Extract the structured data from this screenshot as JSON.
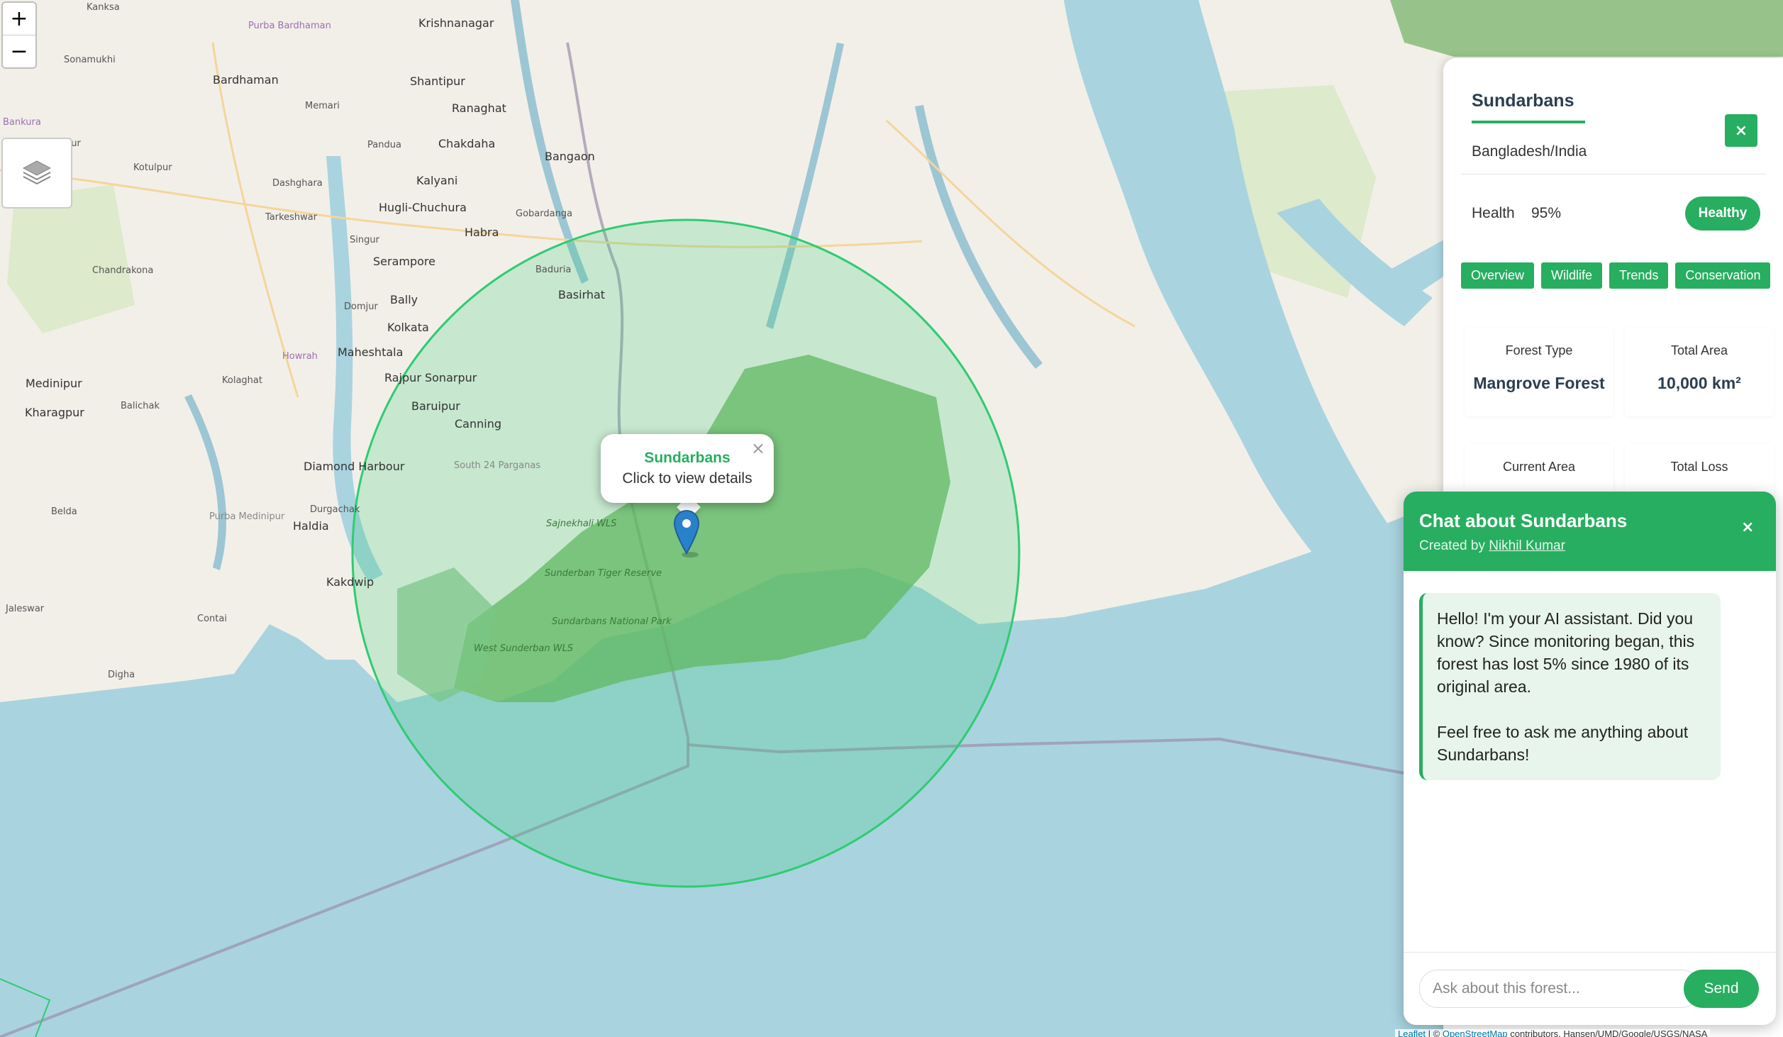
{
  "map": {
    "place_labels": [
      {
        "text": "Kanksa"
      },
      {
        "text": "Krishnanagar"
      },
      {
        "text": "Sonamukhi"
      },
      {
        "text": "Purba Bardhaman"
      },
      {
        "text": "Bardhaman"
      },
      {
        "text": "Shantipur"
      },
      {
        "text": "Memari"
      },
      {
        "text": "Ranaghat"
      },
      {
        "text": "Bankura"
      },
      {
        "text": "Bishnupur"
      },
      {
        "text": "Pandua"
      },
      {
        "text": "Chakdaha"
      },
      {
        "text": "Bangaon"
      },
      {
        "text": "Kotulpur"
      },
      {
        "text": "Dashghara"
      },
      {
        "text": "Kalyani"
      },
      {
        "text": "Hugli-Chuchura"
      },
      {
        "text": "Habra"
      },
      {
        "text": "Gobardanga"
      },
      {
        "text": "Tarkeshwar"
      },
      {
        "text": "Singur"
      },
      {
        "text": "Serampore"
      },
      {
        "text": "Chandrakona"
      },
      {
        "text": "Baduria"
      },
      {
        "text": "Basirhat"
      },
      {
        "text": "Bally"
      },
      {
        "text": "Domjur"
      },
      {
        "text": "Kolkata"
      },
      {
        "text": "Howrah"
      },
      {
        "text": "Maheshtala"
      },
      {
        "text": "Medinipur"
      },
      {
        "text": "Rajpur Sonarpur"
      },
      {
        "text": "Kolaghat"
      },
      {
        "text": "Baruipur"
      },
      {
        "text": "Kharagpur"
      },
      {
        "text": "Balichak"
      },
      {
        "text": "Canning"
      },
      {
        "text": "Diamond Harbour"
      },
      {
        "text": "South 24 Parganas"
      },
      {
        "text": "Belda"
      },
      {
        "text": "Durgachak"
      },
      {
        "text": "Purba Medinipur"
      },
      {
        "text": "Haldia"
      },
      {
        "text": "Kakdwip"
      },
      {
        "text": "Jaleswar"
      },
      {
        "text": "Contai"
      },
      {
        "text": "Digha"
      },
      {
        "text": "Sajnekhali WLS"
      },
      {
        "text": "Sunderban Tiger Reserve"
      },
      {
        "text": "Sundarbans National Park"
      },
      {
        "text": "West Sunderban WLS"
      }
    ]
  },
  "zoom": {
    "in": "+",
    "out": "−"
  },
  "popup": {
    "title": "Sundarbans",
    "subtitle": "Click to view details",
    "close": "×"
  },
  "panel": {
    "title": "Sundarbans",
    "location": "Bangladesh/India",
    "close": "×",
    "health_label": "Health",
    "health_value": "95%",
    "health_status": "Healthy",
    "tabs": [
      "Overview",
      "Wildlife",
      "Trends",
      "Conservation"
    ],
    "stats": [
      {
        "label": "Forest Type",
        "value": "Mangrove Forest"
      },
      {
        "label": "Total Area",
        "value": "10,000 km²"
      },
      {
        "label": "Current Area"
      },
      {
        "label": "Total Loss"
      }
    ]
  },
  "chat": {
    "title": "Chat about Sundarbans",
    "credit_prefix": "Created by ",
    "credit_name": "Nikhil Kumar",
    "close": "×",
    "message_p1": "Hello! I'm your AI assistant. Did you know? Since monitoring began, this forest has lost 5% since 1980 of its original area.",
    "message_p2": "Feel free to ask me anything about Sundarbans!",
    "input_placeholder": "Ask about this forest...",
    "send": "Send"
  },
  "attribution": {
    "leaflet": "Leaflet",
    "sep": " | © ",
    "osm": "OpenStreetMap",
    "rest": " contributors, Hansen/UMD/Google/USGS/NASA"
  },
  "colors": {
    "accent": "#27ae60",
    "water": "#a9d3df",
    "land": "#f2efe9",
    "forest": "#8fc38a",
    "circle_fill": "#2ecc71",
    "marker": "#2a81cb"
  }
}
